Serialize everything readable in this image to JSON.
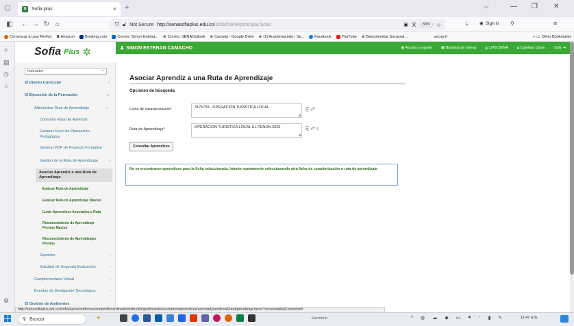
{
  "browser": {
    "tab_title": "Sofia plus",
    "url_security": "Not Secure",
    "url_host": "http://senasofiaplus.edu.co",
    "url_path": "/sofia/home/principal.faces",
    "zoom": "80%",
    "sign_in": "Sign in",
    "other_bookmarks": "Other Bookmarks",
    "bookmarks": [
      "Comenzar a usar Firefox",
      "Amazon",
      "Booking.com",
      "Correo: Simon Esteba...",
      "Correo: SENAOutlook",
      "Carpeta - Google Drive",
      "(1) Academia.edu | Se...",
      "Facebook",
      "YouTube",
      "Bancolombia Sucursal ...",
      "secop II"
    ]
  },
  "app": {
    "logo_sofia": "Sofia",
    "logo_plus": "Plus",
    "user_name": "SIMON ESTEBAN CAMACHO",
    "topnav": [
      "Ayuda y soporte",
      "Bandeja de tareas",
      "LMS SENA",
      "Cambiar Clave",
      "Salir"
    ]
  },
  "sidebar": {
    "role": "Instructor",
    "items": [
      {
        "label": "Diseño Curricular"
      },
      {
        "label": "Ejecución de la Formación"
      },
      {
        "label": "Administrar Ruta de Aprendizaje"
      },
      {
        "label": "Consultar Ruta del Aprendiz"
      },
      {
        "label": "Generar Excel de Planeación Pedagógica"
      },
      {
        "label": "Generar PDF de Proyecto Formativo"
      },
      {
        "label": "Gestion de la Ruta de Aprendizaje"
      },
      {
        "label": "Asociar Aprendiz a una Ruta de Aprendizaje"
      },
      {
        "label": "Evaluar Ruta de Aprendizaje"
      },
      {
        "label": "Evaluar Ruta de Aprendizaje Masivo"
      },
      {
        "label": "Listar Aprendices Asociados a Ruta"
      },
      {
        "label": "Reconocimiento de Aprendizaje Previos Masivo"
      },
      {
        "label": "Reconocimiento de Aprendizajes Previos"
      },
      {
        "label": "Reportes"
      },
      {
        "label": "Solicitud de Segunda Evaluación"
      },
      {
        "label": "Complementaria Virtual"
      },
      {
        "label": "Eventos de Divulgación Tecnológica"
      },
      {
        "label": "Gestión de Ambientes"
      }
    ]
  },
  "main": {
    "title": "Asociar Aprendiz a una Ruta de Aprendizaje",
    "options_heading": "Opciones de búsqueda",
    "ficha_label": "Ficha de caracterización*",
    "ficha_value": "3175739 - OPERACION TURISTICA LOCAL",
    "ruta_label": "Ruta de Aprendizaje*",
    "ruta_value": "OPERACION TURISTICA LOCAL EL PENON 2025",
    "button": "Consultar Aprendices",
    "message": "No se encontraron aprendices para la ficha seleccionada, Intente nuevamente seleccionando otra ficha de caracterización o ruta de aprendizaje"
  },
  "status_url": "http://senasofiaplus.edu.co/sofia/ejecucionformacion/perfilcoordinadorinstructor/gestionruta/asociarrutaaprendices/asociarAprendicesRutaAprendizaje.faces?conversationContext=e#",
  "taskbar": {
    "search": "Buscar",
    "desktop": "Escritorio",
    "clock": "11:47 a.m."
  }
}
